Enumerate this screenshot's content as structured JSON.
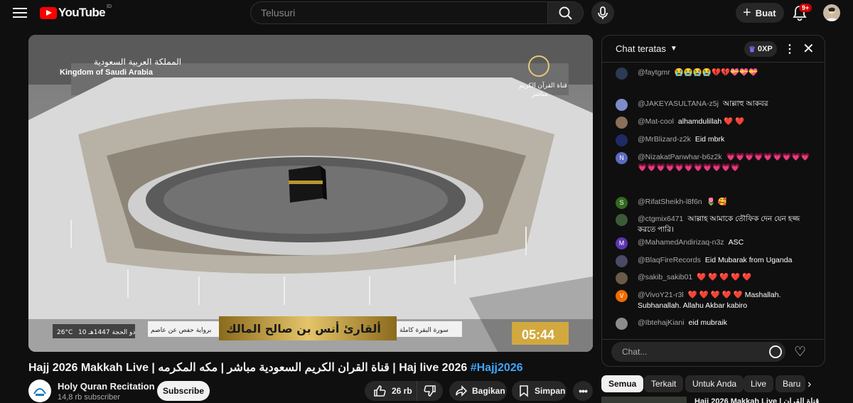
{
  "header": {
    "logo_text": "YouTube",
    "country_code": "ID",
    "search_placeholder": "Telusuri",
    "create_label": "Buat",
    "notification_count": "9+"
  },
  "video": {
    "overlay": {
      "kingdom_ar": "المملكة العربية السعودية",
      "kingdom_en": "Kingdom of Saudi Arabia",
      "channel_ar": "قناة القرآن الكريم",
      "live_ar": "مباشر",
      "reader": "ألقارئ أنس بن صالح المالك",
      "surah": "سورة البقرة كاملة",
      "riwaya": "برواية حفص عن عاصم",
      "date_ar": "10 ذو الحجة 1447هـ",
      "temperature": "26°C",
      "clock": "05:44"
    },
    "title_main": "Hajj 2026 Makkah Live | قناة القران الكريم السعودية مباشر | مكه المكرمه | Haj live 2026",
    "title_tag": "#Hajj2026",
    "channel_name": "Holy Quran Recitation",
    "subscribers": "14,8 rb subscriber",
    "subscribe_label": "Subscribe",
    "likes": "26 rb",
    "share_label": "Bagikan",
    "save_label": "Simpan"
  },
  "chat": {
    "header_label": "Chat teratas",
    "xp_label": "0XP",
    "input_placeholder": "Chat...",
    "messages": [
      {
        "author": "@faytgmr",
        "text": "😭😭😭😭💔💔💝💝💝",
        "avatar": "",
        "avatar_color": "#2b3a55"
      },
      {
        "author": "@JAKEYASULTANA-z5j",
        "text": "আল্লাহু আকবর",
        "avatar": "",
        "avatar_color": "#7b8cc9"
      },
      {
        "author": "@Mat-cool",
        "text": "alhamdulillah ❤️ ❤️",
        "avatar": "",
        "avatar_color": "#8a6f5a"
      },
      {
        "author": "@MrBlizard-z2k",
        "text": "Eid mbrk",
        "avatar": "",
        "avatar_color": "#1f2a66"
      },
      {
        "author": "@NizakatPanwhar-b6z2k",
        "text": "💗💗💗💗💗💗💗💗💗💗💗💗💗💗💗💗💗💗💗💗",
        "avatar": "N",
        "avatar_color": "#5c6bc0"
      },
      {
        "author": "@RifatSheikh-l8f6n",
        "text": "🌷 🥰",
        "avatar": "S",
        "avatar_color": "#33691e"
      },
      {
        "author": "@ctgmix6471",
        "text": "আল্লাহ আমাকে তৌফিক দেন যেন হজ্জ করতে পারি।",
        "avatar": "",
        "avatar_color": "#3b5a3a"
      },
      {
        "author": "@MahamedAndirizaq-n3z",
        "text": "ASC",
        "avatar": "M",
        "avatar_color": "#5e35b1"
      },
      {
        "author": "@BlaqFireRecords",
        "text": "Eid Mubarak from Uganda",
        "avatar": "",
        "avatar_color": "#4a4a66"
      },
      {
        "author": "@sakib_sakib01",
        "text": "❤️ ❤️ ❤️ ❤️ ❤️",
        "avatar": "",
        "avatar_color": "#6b5a4a"
      },
      {
        "author": "@VivoY21-r3l",
        "text": "❤️ ❤️ ❤️ ❤️ ❤️ Mashallah. Subhanallah. Allahu Akbar kabiro",
        "avatar": "V",
        "avatar_color": "#ef6c00"
      },
      {
        "author": "@IbtehajKiani",
        "text": "eid mubraik",
        "avatar": "",
        "avatar_color": "#8c8c8c"
      }
    ]
  },
  "chips": [
    "Semua",
    "Terkait",
    "Untuk Anda",
    "Live",
    "Baru"
  ],
  "recommendation": {
    "title": "Hajj 2026 Makkah Live | قناة القران"
  }
}
